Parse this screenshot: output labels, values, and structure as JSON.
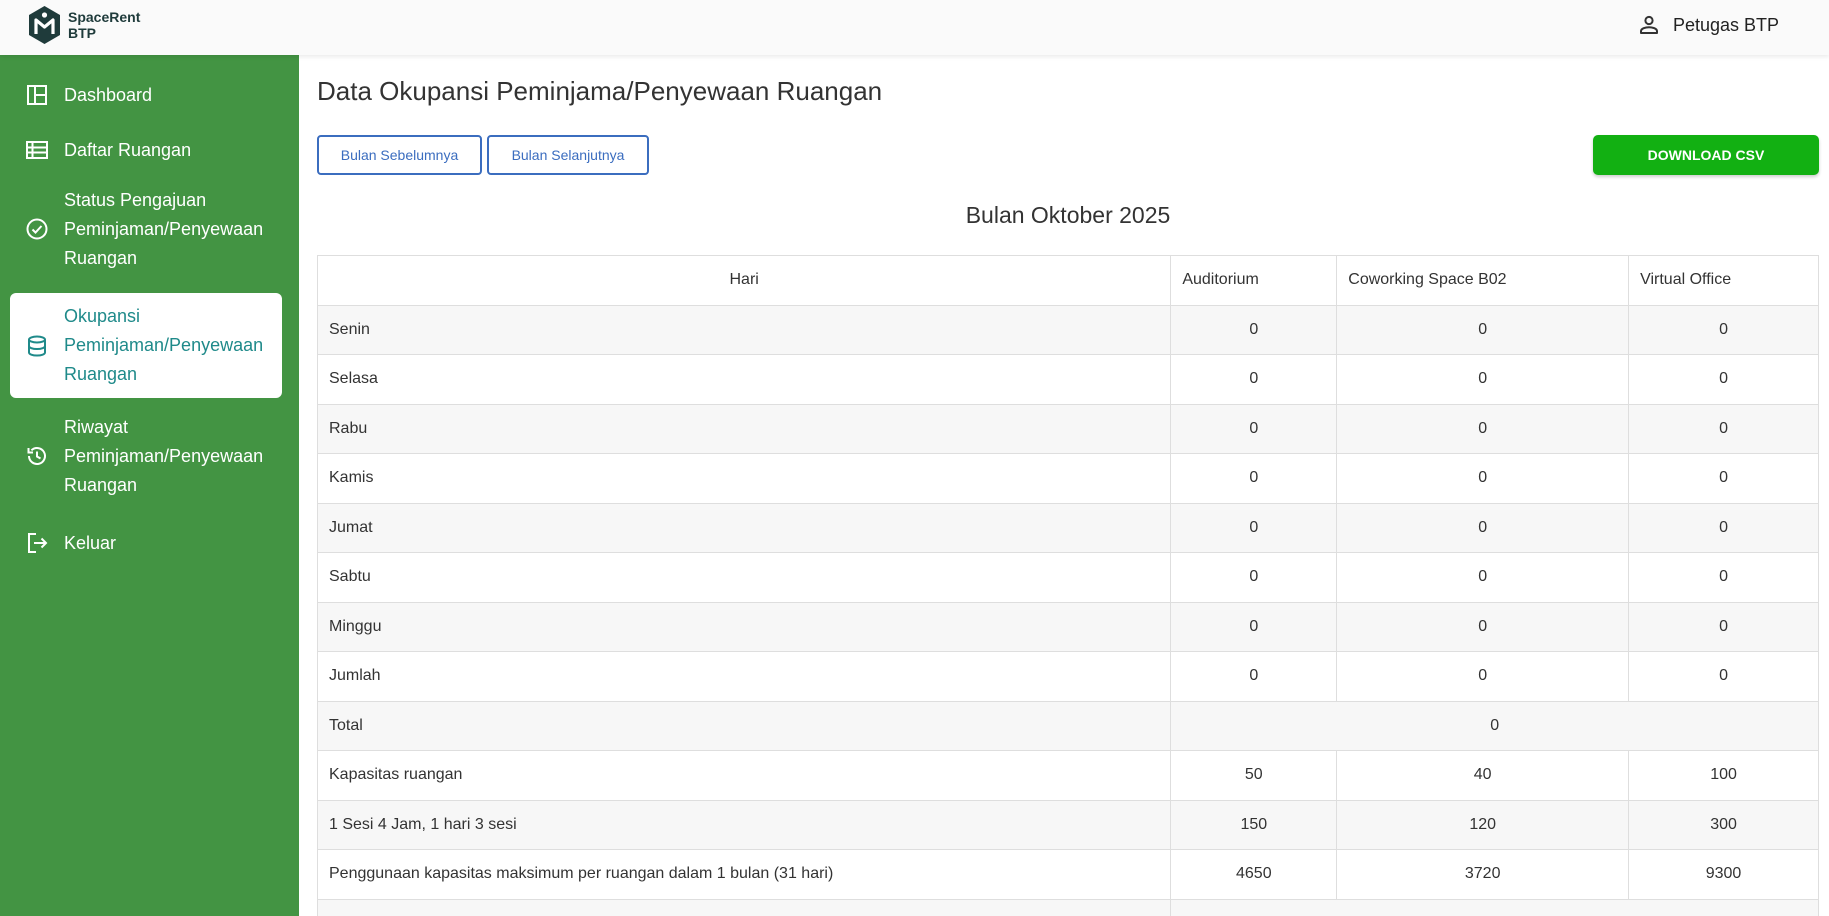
{
  "app": {
    "logo_line1": "SpaceRent",
    "logo_line2": "BTP",
    "user_name": "Petugas BTP"
  },
  "sidebar": {
    "items": [
      {
        "label": "Dashboard",
        "icon": "dashboard-icon"
      },
      {
        "label": "Daftar Ruangan",
        "icon": "table-list-icon"
      },
      {
        "line1": "Status Pengajuan",
        "line2": "Peminjaman/Penyewaan",
        "line3": "Ruangan",
        "icon": "check-circle-icon"
      },
      {
        "line1": "Okupansi",
        "line2": "Peminjaman/Penyewaan",
        "line3": "Ruangan",
        "icon": "database-icon",
        "active": true
      },
      {
        "line1": "Riwayat",
        "line2": "Peminjaman/Penyewaan",
        "line3": "Ruangan",
        "icon": "history-icon"
      },
      {
        "label": "Keluar",
        "icon": "logout-icon"
      }
    ]
  },
  "main": {
    "title": "Data Okupansi Peminjama/Penyewaan Ruangan",
    "prev_button": "Bulan Sebelumnya",
    "next_button": "Bulan Selanjutnya",
    "download_button": "DOWNLOAD CSV",
    "month_title": "Bulan Oktober 2025"
  },
  "table": {
    "headers": [
      "Hari",
      "Auditorium",
      "Coworking Space B02",
      "Virtual Office"
    ],
    "rows": [
      {
        "label": "Senin",
        "values": [
          "0",
          "0",
          "0"
        ]
      },
      {
        "label": "Selasa",
        "values": [
          "0",
          "0",
          "0"
        ]
      },
      {
        "label": "Rabu",
        "values": [
          "0",
          "0",
          "0"
        ]
      },
      {
        "label": "Kamis",
        "values": [
          "0",
          "0",
          "0"
        ]
      },
      {
        "label": "Jumat",
        "values": [
          "0",
          "0",
          "0"
        ]
      },
      {
        "label": "Sabtu",
        "values": [
          "0",
          "0",
          "0"
        ]
      },
      {
        "label": "Minggu",
        "values": [
          "0",
          "0",
          "0"
        ]
      },
      {
        "label": "Jumlah",
        "values": [
          "0",
          "0",
          "0"
        ]
      }
    ],
    "total": {
      "label": "Total",
      "value": "0"
    },
    "capacity_rows": [
      {
        "label": "Kapasitas ruangan",
        "values": [
          "50",
          "40",
          "100"
        ]
      },
      {
        "label": "1 Sesi 4 Jam, 1 hari 3 sesi",
        "values": [
          "150",
          "120",
          "300"
        ]
      },
      {
        "label": "Penggunaan kapasitas maksimum per ruangan dalam 1 bulan (31 hari)",
        "values": [
          "4650",
          "3720",
          "9300"
        ]
      }
    ]
  },
  "colors": {
    "sidebar_bg": "#439443",
    "active_text": "#1f8a8a",
    "button_outline": "#3b6dbf",
    "download_bg": "#12b012"
  }
}
